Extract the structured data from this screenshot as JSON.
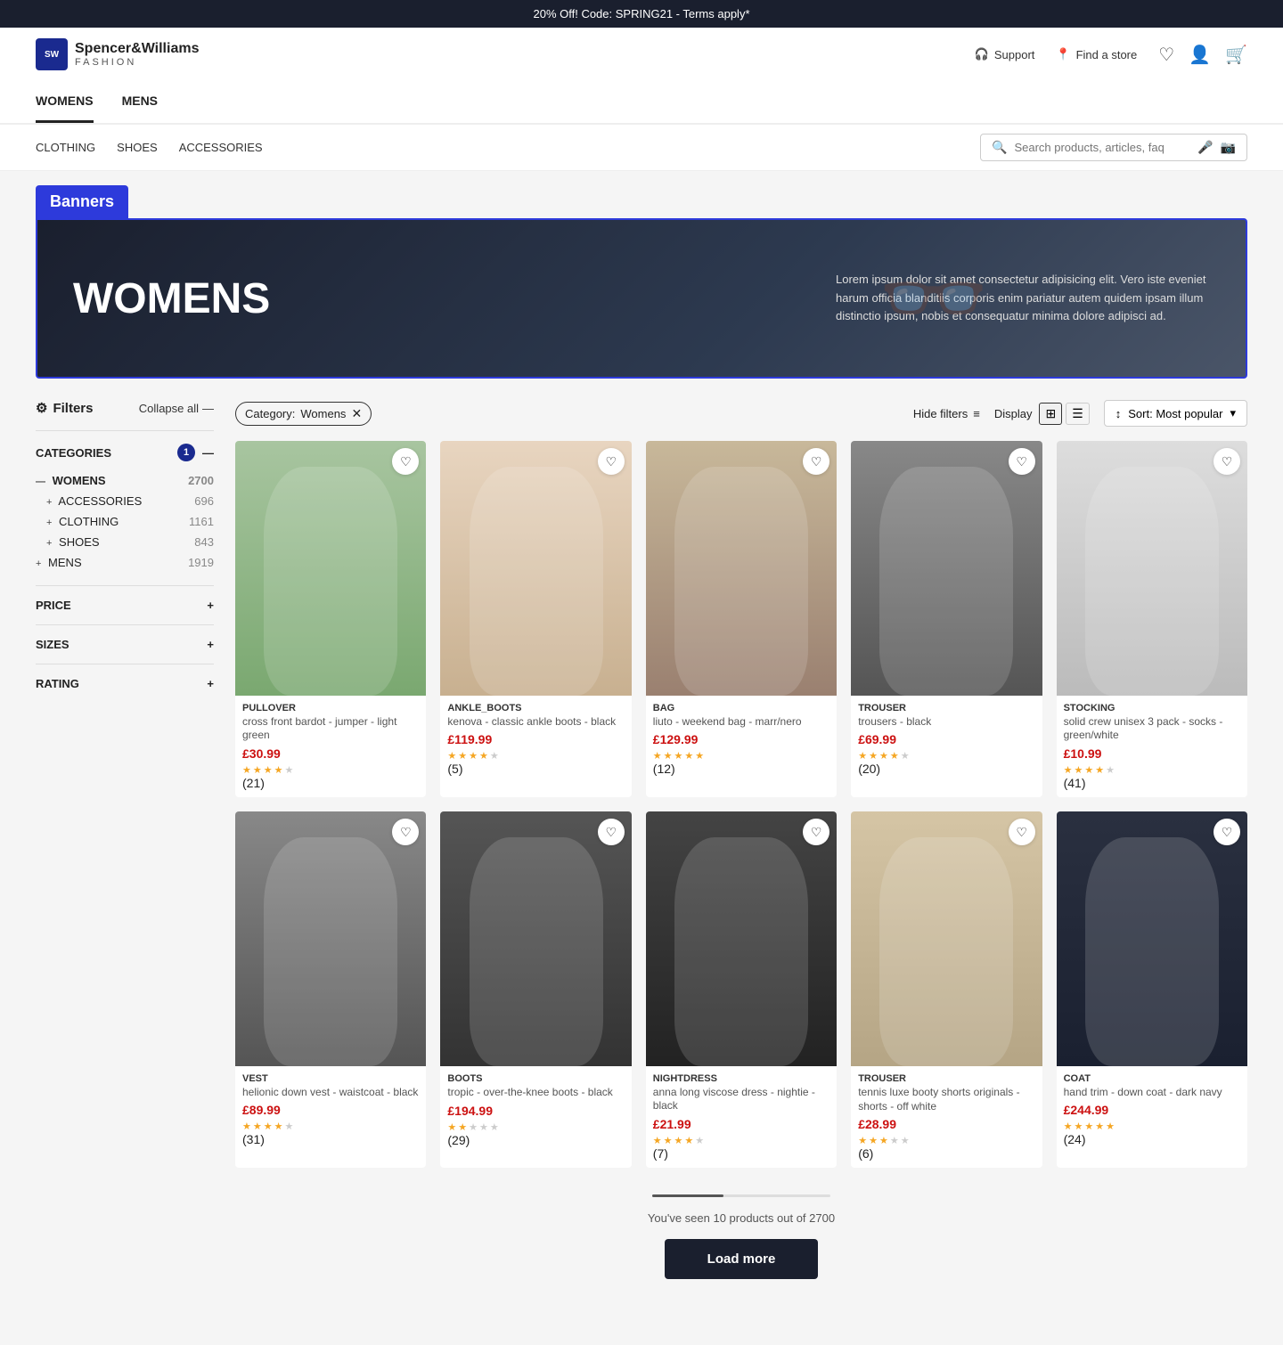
{
  "promo": {
    "text": "20% Off! Code: SPRING21 - Terms apply*"
  },
  "header": {
    "logo_initials": "SW",
    "brand_name": "Spencer&Williams",
    "brand_sub": "FASHION",
    "support_label": "Support",
    "find_store_label": "Find a store"
  },
  "main_nav": {
    "items": [
      {
        "label": "WOMENS",
        "active": true
      },
      {
        "label": "MENS",
        "active": false
      }
    ]
  },
  "sub_nav": {
    "links": [
      "CLOTHING",
      "SHOES",
      "ACCESSORIES"
    ],
    "search_placeholder": "Search products, articles, faq"
  },
  "banners": {
    "label": "Banners",
    "hero_title": "WOMENS",
    "hero_desc": "Lorem ipsum dolor sit amet consectetur adipisicing elit. Vero iste eveniet harum officia blanditiis corporis enim pariatur autem quidem ipsam illum distinctio ipsum, nobis et consequatur minima dolore adipisci ad."
  },
  "filters": {
    "title": "Filters",
    "collapse_label": "Collapse all",
    "category_badge": "1",
    "sections": {
      "categories": {
        "label": "CATEGORIES",
        "items": [
          {
            "name": "WOMENS",
            "count": "2700",
            "level": 0
          },
          {
            "name": "ACCESSORIES",
            "count": "696",
            "level": 1
          },
          {
            "name": "CLOTHING",
            "count": "1161",
            "level": 1
          },
          {
            "name": "SHOES",
            "count": "843",
            "level": 1
          },
          {
            "name": "MENS",
            "count": "1919",
            "level": 0
          }
        ]
      },
      "price": {
        "label": "PRICE"
      },
      "sizes": {
        "label": "SIZES"
      },
      "rating": {
        "label": "RATING"
      }
    }
  },
  "filter_bar": {
    "active_filter_label": "Category:",
    "active_filter_value": "Womens",
    "hide_filters_label": "Hide filters",
    "display_label": "Display",
    "sort_label": "Sort: Most popular"
  },
  "products": [
    {
      "type": "PULLOVER",
      "name": "cross front bardot - jumper - light green",
      "price": "£30.99",
      "rating": 3.5,
      "review_count": 21,
      "img_class": "pullover"
    },
    {
      "type": "ANKLE_BOOTS",
      "name": "kenova - classic ankle boots - black",
      "price": "£119.99",
      "rating": 3.5,
      "review_count": 5,
      "img_class": "ankle-boots"
    },
    {
      "type": "BAG",
      "name": "liuto - weekend bag - marr/nero",
      "price": "£129.99",
      "rating": 5,
      "review_count": 12,
      "img_class": "bag"
    },
    {
      "type": "TROUSER",
      "name": "trousers - black",
      "price": "£69.99",
      "rating": 3.5,
      "review_count": 20,
      "img_class": "trouser"
    },
    {
      "type": "STOCKING",
      "name": "solid crew unisex 3 pack - socks - green/white",
      "price": "£10.99",
      "rating": 3.5,
      "review_count": 41,
      "img_class": "stocking"
    },
    {
      "type": "VEST",
      "name": "helionic down vest - waistcoat - black",
      "price": "£89.99",
      "rating": 4,
      "review_count": 31,
      "img_class": "vest"
    },
    {
      "type": "BOOTS",
      "name": "tropic - over-the-knee boots - black",
      "price": "£194.99",
      "rating": 1.5,
      "review_count": 29,
      "img_class": "boots"
    },
    {
      "type": "NIGHTDRESS",
      "name": "anna long viscose dress - nightie - black",
      "price": "£21.99",
      "rating": 4,
      "review_count": 7,
      "img_class": "nightdress"
    },
    {
      "type": "TROUSER",
      "name": "tennis luxe booty shorts originals - shorts - off white",
      "price": "£28.99",
      "rating": 2.5,
      "review_count": 6,
      "img_class": "shorts"
    },
    {
      "type": "COAT",
      "name": "hand trim - down coat - dark navy",
      "price": "£244.99",
      "rating": 5,
      "review_count": 24,
      "img_class": "coat"
    }
  ],
  "pagination": {
    "seen_label": "You've seen 10 products out of 2700",
    "load_more_label": "Load more",
    "progress_pct": 0.4
  }
}
